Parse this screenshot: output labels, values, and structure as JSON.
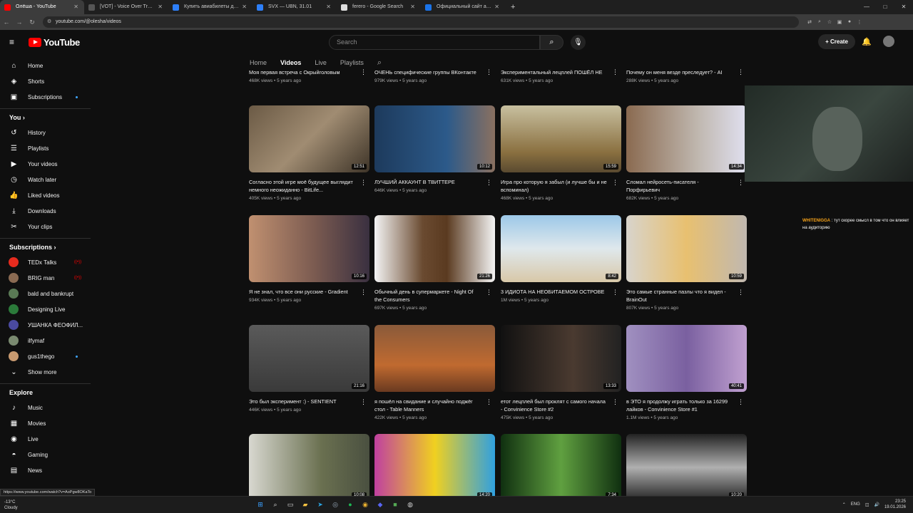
{
  "browser": {
    "tabs": [
      {
        "title": "Олёша - YouTube",
        "active": true,
        "color": "#ff0000"
      },
      {
        "title": "[VOT] - Voice Over Translation",
        "color": "#555555"
      },
      {
        "title": "Купить авиабилеты дешево о",
        "color": "#2d7ff9"
      },
      {
        "title": "SVX — UBN, 31.01",
        "color": "#2d7ff9"
      },
      {
        "title": "ferero - Google Search",
        "color": "#dddddd"
      },
      {
        "title": "Официальный сайт авиакомп",
        "color": "#1a73e8"
      }
    ],
    "new_tab": "+",
    "url": "youtube.com/@olesha/videos"
  },
  "header": {
    "logo_text": "YouTube",
    "search_placeholder": "Search",
    "create_label": "Create"
  },
  "sidebar": {
    "main": [
      {
        "label": "Home",
        "icon": "home-icon",
        "glyph": "⌂"
      },
      {
        "label": "Shorts",
        "icon": "shorts-icon",
        "glyph": "◈"
      },
      {
        "label": "Subscriptions",
        "icon": "subscriptions-icon",
        "glyph": "▣"
      }
    ],
    "you_heading": "You",
    "you": [
      {
        "label": "History",
        "icon": "history-icon",
        "glyph": "↺"
      },
      {
        "label": "Playlists",
        "icon": "playlists-icon",
        "glyph": "☰"
      },
      {
        "label": "Your videos",
        "icon": "your-videos-icon",
        "glyph": "▶"
      },
      {
        "label": "Watch later",
        "icon": "watch-later-icon",
        "glyph": "◷"
      },
      {
        "label": "Liked videos",
        "icon": "like-icon",
        "glyph": "👍"
      },
      {
        "label": "Downloads",
        "icon": "download-icon",
        "glyph": "⤓"
      },
      {
        "label": "Your clips",
        "icon": "scissors-icon",
        "glyph": "✂"
      }
    ],
    "subs_heading": "Subscriptions",
    "subs": [
      {
        "label": "TEDx Talks",
        "color": "#e62b1e",
        "badge": "live"
      },
      {
        "label": "BRIG man",
        "color": "#8a6a52",
        "badge": "live"
      },
      {
        "label": "bald and bankrupt",
        "color": "#5a7a55",
        "badge": ""
      },
      {
        "label": "Designing Live",
        "color": "#2b7a3a",
        "badge": ""
      },
      {
        "label": "УШАНКА ФЕОФИЛ...",
        "color": "#4a4aa0",
        "badge": ""
      },
      {
        "label": "ilfymaf",
        "color": "#7a8a70",
        "badge": ""
      },
      {
        "label": "gus1thego",
        "color": "#c89a70",
        "badge": "dot"
      }
    ],
    "show_more": "Show more",
    "explore_heading": "Explore",
    "explore": [
      {
        "label": "Music",
        "icon": "music-icon",
        "glyph": "♪"
      },
      {
        "label": "Movies",
        "icon": "movies-icon",
        "glyph": "▦"
      },
      {
        "label": "Live",
        "icon": "live-icon",
        "glyph": "◉"
      },
      {
        "label": "Gaming",
        "icon": "gaming-icon",
        "glyph": "◓"
      },
      {
        "label": "News",
        "icon": "news-icon",
        "glyph": "▤"
      }
    ]
  },
  "channel_tabs": [
    "Home",
    "Videos",
    "Live",
    "Playlists"
  ],
  "top_partial": [
    {
      "title": "Моя первая встреча с Окрыйголовым",
      "views": "468K views",
      "age": "5 years ago"
    },
    {
      "title": "ОЧЕНЬ специфические группы ВКонтакте",
      "views": "979K views",
      "age": "5 years ago"
    },
    {
      "title": "Экспериментальный лецплей ПОШЁЛ НЕ ПО ПЛАНУ",
      "views": "631K views",
      "age": "5 years ago"
    },
    {
      "title": "Почему он меня везде преследует? - AI Dungeon",
      "views": "288K views",
      "age": "5 years ago"
    }
  ],
  "videos": [
    {
      "title": "Согласно этой игре моё будущее выглядит немного неожиданно - BitLife...",
      "views": "405K views",
      "age": "5 years ago",
      "duration": "12:51",
      "bg": "linear-gradient(135deg,#6b5a45,#a08c72 50,#3e3428)"
    },
    {
      "title": "ЛУЧШИЙ АККАУНТ В ТВИТТЕРЕ",
      "views": "646K views",
      "age": "5 years ago",
      "duration": "10:12",
      "bg": "linear-gradient(90deg,#1d3a5c,#2c5a8a 60,#8a7060)"
    },
    {
      "title": "Игра про которую я забыл (и лучше бы и не вспоминал)",
      "views": "468K views",
      "age": "5 years ago",
      "duration": "15:59",
      "bg": "linear-gradient(180deg,#c8c0a0,#8a7040 70,#5a4a30)"
    },
    {
      "title": "Сломал нейросеть-писателя - Порфирьевич",
      "views": "682K views",
      "age": "5 years ago",
      "duration": "14:34",
      "bg": "linear-gradient(90deg,#8a6a50,#c0b8b0 60,#e0e0f0)"
    },
    {
      "title": "Я не знал, что все они русские - Gradient",
      "views": "934K views",
      "age": "5 years ago",
      "duration": "10:16",
      "bg": "linear-gradient(90deg,#c09070,#7a5a50 55,#3a3040)"
    },
    {
      "title": "Обычный день в супермаркете - Night Of the Consumers",
      "views": "697K views",
      "age": "5 years ago",
      "duration": "21:26",
      "bg": "linear-gradient(90deg,#f4f4f4,#6a4a30 40,#5a3a20 60,#f4f4f4)"
    },
    {
      "title": "3 ИДИОТА НА НЕОБИТАЕМОМ ОСТРОВЕ",
      "views": "1M views",
      "age": "5 years ago",
      "duration": "8:42",
      "bg": "linear-gradient(180deg,#9cc8e8,#dfe8ec 50,#d8c8a8)"
    },
    {
      "title": "Это самые странные пазлы что я видел - BrainOut",
      "views": "807K views",
      "age": "5 years ago",
      "duration": "10:59",
      "bg": "linear-gradient(90deg,#d8d4cc,#e8c070 50,#c0b8b0)"
    },
    {
      "title": "Это был эксперимент :) - SENTIENT",
      "views": "446K views",
      "age": "5 years ago",
      "duration": "21:16",
      "bg": "linear-gradient(180deg,#5a5a5a,#3a3a3a)"
    },
    {
      "title": "я пошёл на свидание и случайно поджёг стол - Table Manners",
      "views": "422K views",
      "age": "5 years ago",
      "duration": "",
      "bg": "linear-gradient(180deg,#8a5a3a,#c06a30 60,#6a3a20)"
    },
    {
      "title": "етот лецплей был проклят с самого начала - Convinience Store #2",
      "views": "475K views",
      "age": "5 years ago",
      "duration": "13:33",
      "bg": "linear-gradient(90deg,#111,#4a3a30 60,#222)"
    },
    {
      "title": "в ЭТО я продолжу играть только за 16299 лайков - Convinience Store #1",
      "views": "1.1M views",
      "age": "5 years ago",
      "duration": "40:41",
      "bg": "linear-gradient(90deg,#a090c0,#7a60a0 50,#c0a0d0)"
    },
    {
      "title": "",
      "views": "",
      "age": "",
      "duration": "10:08",
      "bg": "linear-gradient(90deg,#d8d8d0,#6a7050 60,#4a5040)"
    },
    {
      "title": "",
      "views": "",
      "age": "",
      "duration": "14:20",
      "bg": "linear-gradient(90deg,#c040a0,#f0d020 50,#30a0e0)"
    },
    {
      "title": "",
      "views": "",
      "age": "",
      "duration": "7:34",
      "bg": "linear-gradient(90deg,#103010,#60a040 50,#103010)"
    },
    {
      "title": "",
      "views": "",
      "age": "",
      "duration": "10:20",
      "bg": "linear-gradient(180deg,#222,#b0b0b0 50,#222)"
    }
  ],
  "chat": {
    "user": "WHITENIGGA",
    "message": ": тут скорее смысл в том что он влияет на аудиторию"
  },
  "status_url": "https://www.youtube.com/watch?v=AoPgw8OKaTo",
  "taskbar": {
    "temp": "-13°C",
    "weather": "Cloudy",
    "lang": "ENG",
    "time": "23:25",
    "date": "19.01.2026"
  }
}
